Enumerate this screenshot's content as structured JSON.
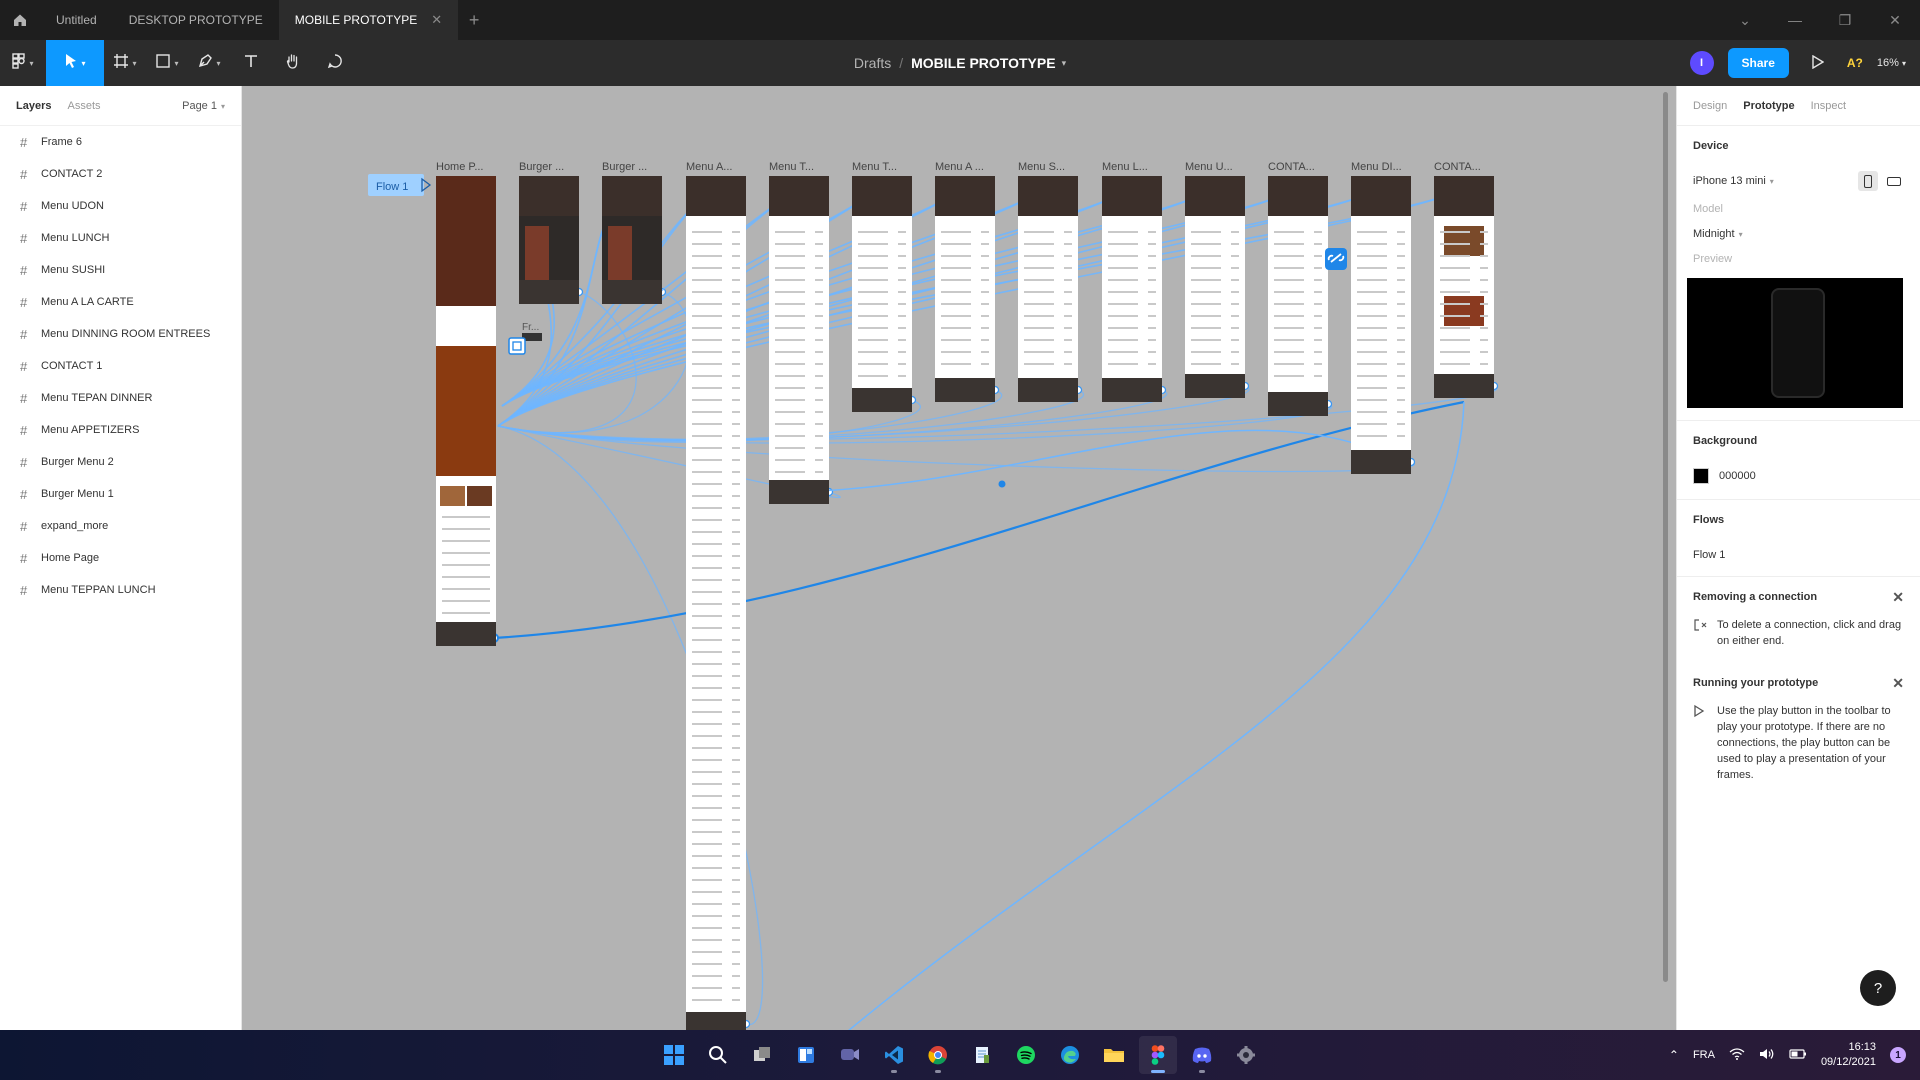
{
  "tabs": [
    {
      "label": "Untitled",
      "active": false
    },
    {
      "label": "DESKTOP PROTOTYPE",
      "active": false
    },
    {
      "label": "MOBILE PROTOTYPE",
      "active": true
    }
  ],
  "toolbar": {
    "breadcrumb_parent": "Drafts",
    "breadcrumb_sep": "/",
    "file_name": "MOBILE PROTOTYPE",
    "avatar_initial": "I",
    "share_label": "Share",
    "a11y_label": "A?",
    "zoom_label": "16%"
  },
  "left_panel": {
    "tab_layers": "Layers",
    "tab_assets": "Assets",
    "page_label": "Page 1",
    "layers": [
      "Frame 6",
      "CONTACT 2",
      "Menu UDON",
      "Menu LUNCH",
      "Menu SUSHI",
      "Menu A LA CARTE",
      "Menu DINNING ROOM ENTREES",
      "CONTACT 1",
      "Menu TEPAN DINNER",
      "Menu APPETIZERS",
      "Burger Menu 2",
      "Burger Menu 1",
      "expand_more",
      "Home Page",
      "Menu TEPPAN LUNCH"
    ]
  },
  "canvas": {
    "flow_label": "Flow 1",
    "small_frame_label": "Fr...",
    "frames": [
      {
        "label": "Home P...",
        "height": 470
      },
      {
        "label": "Burger ...",
        "height": 128
      },
      {
        "label": "Burger ...",
        "height": 128
      },
      {
        "label": "Menu A...",
        "height": 860
      },
      {
        "label": "Menu T...",
        "height": 328
      },
      {
        "label": "Menu T...",
        "height": 236
      },
      {
        "label": "Menu A ...",
        "height": 226
      },
      {
        "label": "Menu S...",
        "height": 226
      },
      {
        "label": "Menu L...",
        "height": 226
      },
      {
        "label": "Menu U...",
        "height": 222
      },
      {
        "label": "CONTA...",
        "height": 240
      },
      {
        "label": "Menu DI...",
        "height": 298
      },
      {
        "label": "CONTA...",
        "height": 222
      }
    ]
  },
  "right_panel": {
    "tab_design": "Design",
    "tab_prototype": "Prototype",
    "tab_inspect": "Inspect",
    "device_header": "Device",
    "device_value": "iPhone 13 mini",
    "model_label": "Model",
    "model_value": "Midnight",
    "preview_label": "Preview",
    "background_header": "Background",
    "background_hex": "000000",
    "flows_header": "Flows",
    "flow_item": "Flow 1",
    "removing_title": "Removing a connection",
    "removing_text": "To delete a connection, click and drag on either end.",
    "running_title": "Running your prototype",
    "running_text": "Use the play button in the toolbar to play your prototype. If there are no connections, the play button can be used to play a presentation of your frames.",
    "help": "?"
  },
  "taskbar": {
    "apps": [
      "windows-start",
      "search",
      "task-view",
      "widgets",
      "teams-chat",
      "vscode",
      "chrome",
      "notepad",
      "spotify",
      "edge",
      "file-explorer",
      "figma",
      "discord",
      "settings"
    ],
    "language": "FRA",
    "time": "16:13",
    "date": "09/12/2021",
    "notifications": "1"
  },
  "colors": {
    "accent": "#0d99ff",
    "canvas_bg": "#b3b3b3",
    "connector": "#6fb6ff",
    "frame_dark": "#3b2f2a"
  }
}
